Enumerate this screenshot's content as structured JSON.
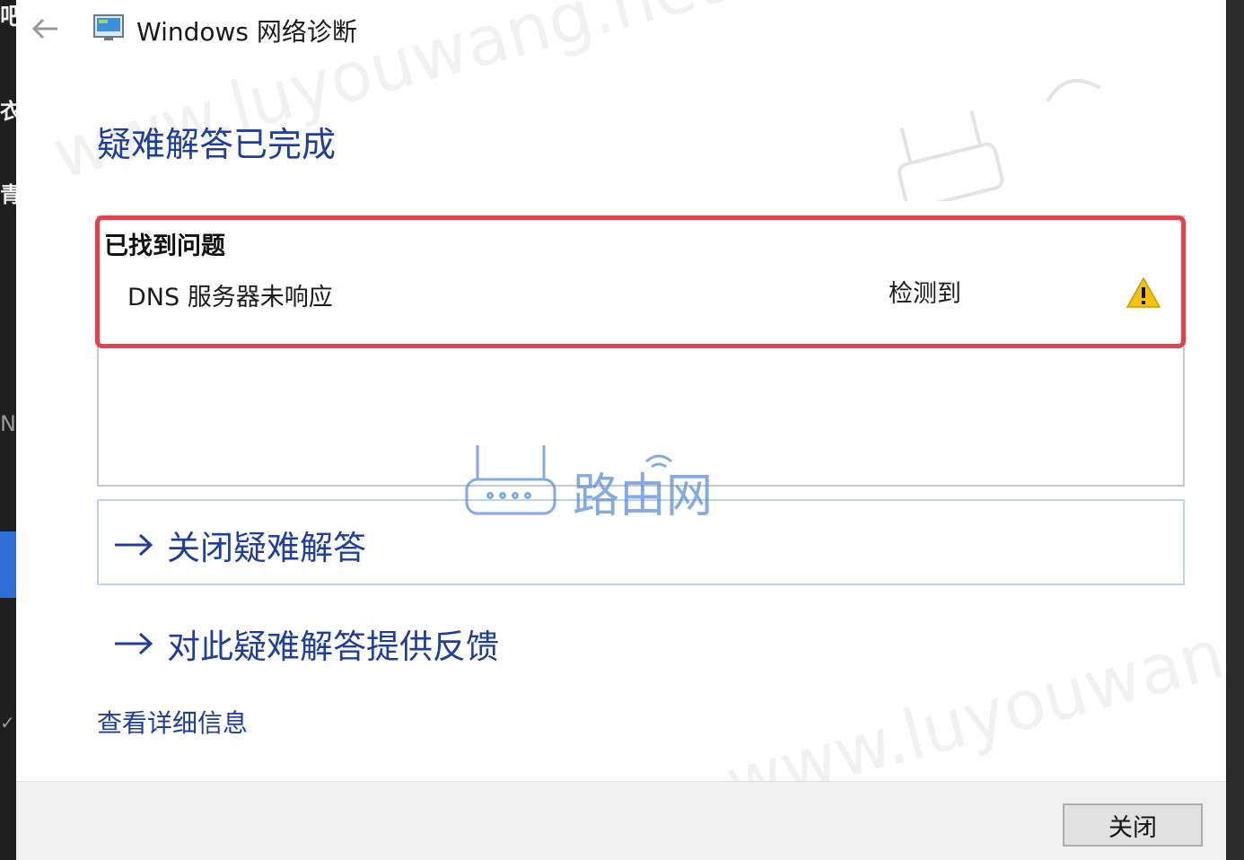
{
  "window": {
    "title": "Windows 网络诊断",
    "back_icon": "back-arrow-icon",
    "app_icon": "network-diagnostics-icon"
  },
  "main": {
    "heading": "疑难解答已完成",
    "problems": {
      "title": "已找到问题",
      "items": [
        {
          "name": "DNS 服务器未响应",
          "status": "检测到",
          "icon": "warning-icon",
          "icon_color": "#f5c211"
        }
      ]
    },
    "commands": [
      {
        "label": "关闭疑难解答",
        "icon": "arrow-right-icon"
      },
      {
        "label": "对此疑难解答提供反馈",
        "icon": "arrow-right-icon"
      }
    ],
    "details_link": "查看详细信息"
  },
  "footer": {
    "close_label": "关闭"
  },
  "watermark": {
    "text": "www.luyouwang.net",
    "logo_text": "路由网"
  },
  "colors": {
    "heading_blue": "#1f3e9b",
    "highlight_red": "#e0434b",
    "watermark_blue": "#5b8fd6"
  }
}
